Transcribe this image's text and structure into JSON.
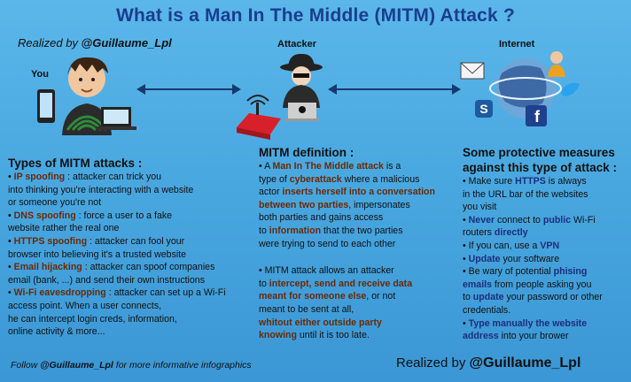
{
  "title": "What is a Man In The Middle (MITM) Attack ?",
  "realized_top": {
    "prefix": "Realized by ",
    "handle": "@Guillaume_Lpl"
  },
  "labels": {
    "you": "You",
    "attacker": "Attacker",
    "internet": "Internet"
  },
  "icons": [
    "user-avatar-icon",
    "smartphone-icon",
    "laptop-icon",
    "wifi-waves-icon",
    "hacker-icon",
    "router-icon",
    "globe-icon",
    "email-icon",
    "skype-icon",
    "facebook-icon",
    "twitter-icon",
    "person-icon"
  ],
  "types": {
    "heading": "Types of MITM attacks :",
    "items": [
      {
        "name": "IP spoofing",
        "text1": " : attacker can trick you",
        "text2": "into thinking you're interacting with a website",
        "text3": "or someone you're not"
      },
      {
        "name": "DNS spoofing",
        "text1": " : force a user to a fake",
        "text2": "website rather the real one"
      },
      {
        "name": "HTTPS spoofing",
        "text1": " : attacker can fool your",
        "text2": "browser into believing it's a trusted website"
      },
      {
        "name": "Email hijacking",
        "text1": " : attacker can spoof companies",
        "text2": "email (bank, ...) and send their own instructions"
      },
      {
        "name": "Wi-Fi eavesdropping",
        "text1": " :  attacker can set up a Wi-Fi",
        "text2": "access point. When a user connects,",
        "text3": "he can intercept login creds, information,",
        "text4": "online activity & more..."
      }
    ]
  },
  "definition": {
    "heading": "MITM definition :",
    "p1": {
      "a": "• A ",
      "b": "Man In The Middle attack",
      "c": " is a",
      "d": "type of ",
      "e": "cyberattack",
      "f": " where a malicious",
      "g": "actor ",
      "h": "inserts herself into a conversation",
      "i": "between two parties",
      "j": ", impersonates",
      "k": "both parties and gains access",
      "l": " to ",
      "m": "information",
      "n": " that the two parties",
      "o": "were trying to send to each other"
    },
    "p2": {
      "a": "• MITM attack allows an attacker",
      "b": "to ",
      "c": "intercept, send and receive data",
      "d": "meant for someone else",
      "e": ", or not",
      "f": "meant to be sent at all,",
      "g": "whitout either outside party",
      "h": "knowing",
      "i": " until it is too late."
    }
  },
  "measures": {
    "heading1": "Some protective measures",
    "heading2": "against this type of attack :",
    "items": [
      {
        "a": "• Make sure ",
        "b": "HTTPS",
        "c": " is always",
        "d": "in the URL bar of the websites",
        "e": "you visit"
      },
      {
        "a": "• ",
        "b": "Never",
        "c": " connect to ",
        "d": "public",
        "e": " Wi-Fi",
        "f": "routers ",
        "g": "directly"
      },
      {
        "a": "• If you can, use a ",
        "b": "VPN"
      },
      {
        "a": "• ",
        "b": "Update",
        "c": " your software"
      },
      {
        "a": "• Be wary of potential ",
        "b": "phising",
        "c": "emails",
        "d": " from people asking you",
        "e": "to ",
        "f": "update",
        "g": " your password or other",
        "h": "credentials."
      },
      {
        "a": "• ",
        "b": "Type manually the website",
        "c": "address",
        "d": " into your brower"
      }
    ]
  },
  "footer": {
    "left_prefix": "Follow ",
    "left_handle": "@Guillaume_Lpl",
    "left_suffix": " for more informative infographics",
    "right_prefix": "Realized by ",
    "right_handle": "@Guillaume_Lpl"
  }
}
